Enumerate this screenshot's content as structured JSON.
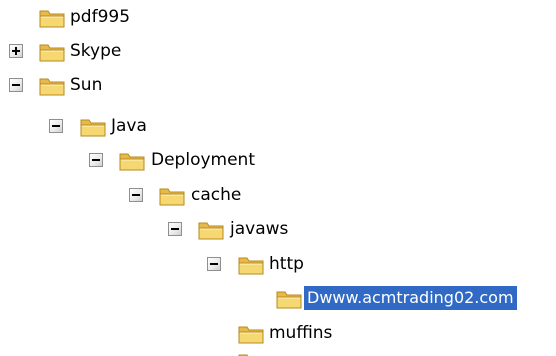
{
  "tree": {
    "nodes": [
      {
        "label": "pdf995",
        "expander": "none",
        "selected": false
      },
      {
        "label": "Skype",
        "expander": "collapsed",
        "selected": false
      },
      {
        "label": "Sun",
        "expander": "expanded",
        "selected": false
      },
      {
        "label": "Java",
        "expander": "expanded",
        "selected": false
      },
      {
        "label": "Deployment",
        "expander": "expanded",
        "selected": false
      },
      {
        "label": "cache",
        "expander": "expanded",
        "selected": false
      },
      {
        "label": "javaws",
        "expander": "expanded",
        "selected": false
      },
      {
        "label": "http",
        "expander": "expanded",
        "selected": false
      },
      {
        "label": "Dwww.acmtrading02.com",
        "expander": "none",
        "selected": true
      },
      {
        "label": "muffins",
        "expander": "none",
        "selected": false
      }
    ]
  },
  "colors": {
    "selection_bg": "#316ac5",
    "selection_text": "#ffffff",
    "folder_fill": "#f3d36b",
    "folder_edge": "#b88a1d"
  },
  "icons": {
    "folder": "folder-icon",
    "expanded": "minus-box-icon",
    "collapsed": "plus-box-icon"
  }
}
